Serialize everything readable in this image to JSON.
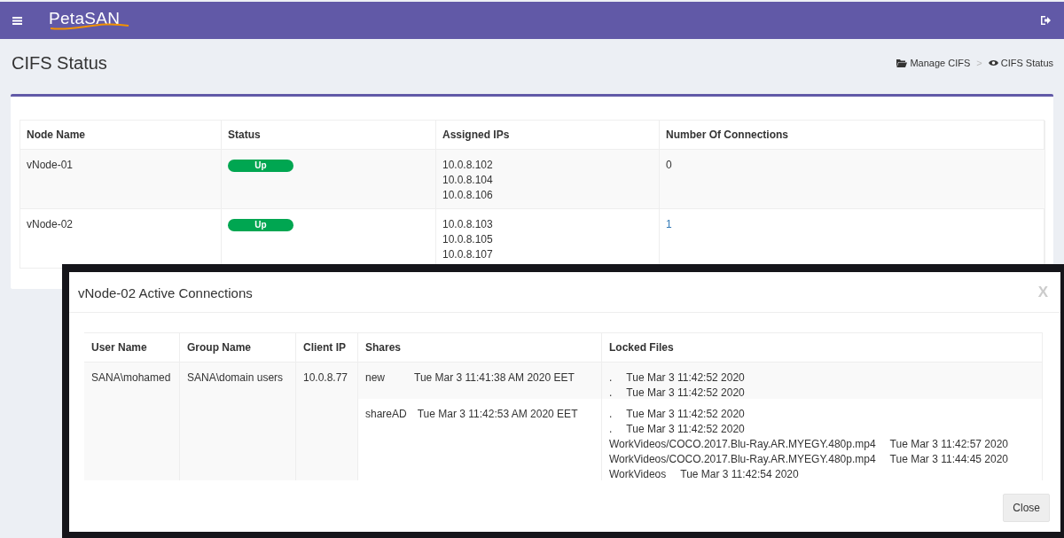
{
  "header": {
    "logo": "PetaSAN"
  },
  "page_title": "CIFS Status",
  "breadcrumbs": [
    {
      "kind": "folder",
      "label": "Manage CIFS"
    },
    {
      "kind": "eye",
      "label": "CIFS Status"
    }
  ],
  "breadcrumb_separator": ">",
  "table": {
    "columns": [
      "Node Name",
      "Status",
      "Assigned IPs",
      "Number Of Connections"
    ],
    "rows": [
      {
        "node": "vNode-01",
        "status": {
          "label": "Up",
          "color": "#00a651"
        },
        "ips": [
          "10.0.8.102",
          "10.0.8.104",
          "10.0.8.106"
        ],
        "connections": "0",
        "link": false
      },
      {
        "node": "vNode-02",
        "status": {
          "label": "Up",
          "color": "#00a651"
        },
        "ips": [
          "10.0.8.103",
          "10.0.8.105",
          "10.0.8.107"
        ],
        "connections": "1",
        "link": true
      }
    ]
  },
  "modal": {
    "title": "vNode-02 Active Connections",
    "close_mark": "X",
    "columns": [
      "User Name",
      "Group Name",
      "Client IP",
      "Shares",
      "Locked Files"
    ],
    "rows": [
      {
        "user": "SANA\\mohamed",
        "group": "SANA\\domain users",
        "client_ip": "10.0.8.77",
        "shares": [
          {
            "name": "new",
            "time": "Tue Mar 3 11:41:38 AM 2020 EET",
            "locked_files": [
              {
                "path": ".",
                "time": "Tue Mar 3 11:42:52 2020"
              },
              {
                "path": ".",
                "time": "Tue Mar 3 11:42:52 2020"
              }
            ]
          },
          {
            "name": "shareAD",
            "time": "Tue Mar 3 11:42:53 AM 2020 EET",
            "locked_files": [
              {
                "path": ".",
                "time": "Tue Mar 3 11:42:52 2020"
              },
              {
                "path": ".",
                "time": "Tue Mar 3 11:42:52 2020"
              },
              {
                "path": "WorkVideos/COCO.2017.Blu-Ray.AR.MYEGY.480p.mp4",
                "time": "Tue Mar 3 11:42:57 2020"
              },
              {
                "path": "WorkVideos/COCO.2017.Blu-Ray.AR.MYEGY.480p.mp4",
                "time": "Tue Mar 3 11:44:45 2020"
              },
              {
                "path": "WorkVideos",
                "time": "Tue Mar 3 11:42:54 2020"
              }
            ]
          }
        ]
      }
    ],
    "close_button": "Close"
  }
}
